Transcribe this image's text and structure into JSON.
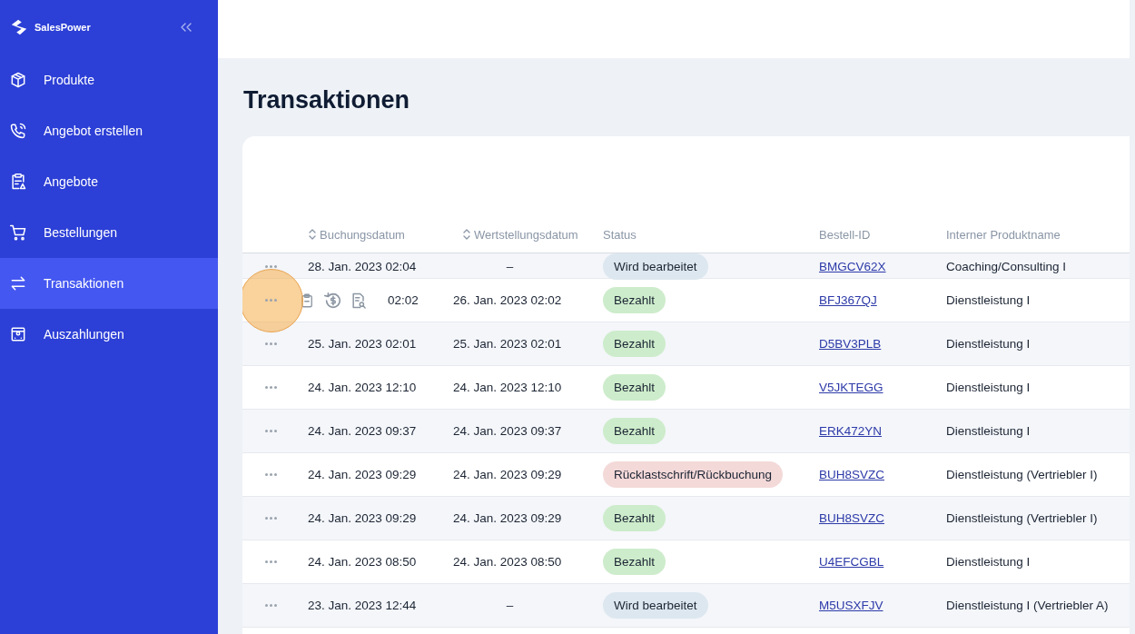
{
  "brand": {
    "name": "SalesPower"
  },
  "sidebar": {
    "items": [
      {
        "label": "Produkte",
        "kind": "box",
        "selected": false
      },
      {
        "label": "Angebot erstellen",
        "kind": "phone",
        "selected": false
      },
      {
        "label": "Angebote",
        "kind": "clipboard",
        "selected": false
      },
      {
        "label": "Bestellungen",
        "kind": "cart",
        "selected": false
      },
      {
        "label": "Transaktionen",
        "kind": "swap",
        "selected": true
      },
      {
        "label": "Auszahlungen",
        "kind": "payout",
        "selected": false
      }
    ]
  },
  "page": {
    "title": "Transaktionen"
  },
  "table": {
    "columns": [
      {
        "label": "Buchungsdatum",
        "sortable": true
      },
      {
        "label": "Wertstellungsdatum",
        "sortable": true
      },
      {
        "label": "Status",
        "sortable": false
      },
      {
        "label": "Bestell-ID",
        "sortable": false
      },
      {
        "label": "Interner Produktname",
        "sortable": false
      }
    ],
    "rows": [
      {
        "booking": "28. Jan. 2023 02:04",
        "value": "–",
        "status": "Wird bearbeitet",
        "color": "#dde7ef",
        "order_id": "BMGCV62X",
        "product": "Coaching/Consulting I",
        "hovered": false
      },
      {
        "booking": "02:02",
        "value": "26. Jan. 2023 02:02",
        "status": "Bezahlt",
        "color": "#cdeccb",
        "order_id": "BFJ367QJ",
        "product": "Dienstleistung I",
        "hovered": true
      },
      {
        "booking": "25. Jan. 2023 02:01",
        "value": "25. Jan. 2023 02:01",
        "status": "Bezahlt",
        "color": "#cdeccb",
        "order_id": "D5BV3PLB",
        "product": "Dienstleistung I",
        "hovered": false
      },
      {
        "booking": "24. Jan. 2023 12:10",
        "value": "24. Jan. 2023 12:10",
        "status": "Bezahlt",
        "color": "#cdeccb",
        "order_id": "V5JKTEGG",
        "product": "Dienstleistung I",
        "hovered": false
      },
      {
        "booking": "24. Jan. 2023 09:37",
        "value": "24. Jan. 2023 09:37",
        "status": "Bezahlt",
        "color": "#cdeccb",
        "order_id": "ERK472YN",
        "product": "Dienstleistung I",
        "hovered": false
      },
      {
        "booking": "24. Jan. 2023 09:29",
        "value": "24. Jan. 2023 09:29",
        "status": "Rücklastschrift/Rückbuchung",
        "color": "#f4d9d9",
        "order_id": "BUH8SVZC",
        "product": "Dienstleistung (Vertriebler I)",
        "hovered": false
      },
      {
        "booking": "24. Jan. 2023 09:29",
        "value": "24. Jan. 2023 09:29",
        "status": "Bezahlt",
        "color": "#cdeccb",
        "order_id": "BUH8SVZC",
        "product": "Dienstleistung (Vertriebler I)",
        "hovered": false
      },
      {
        "booking": "24. Jan. 2023 08:50",
        "value": "24. Jan. 2023 08:50",
        "status": "Bezahlt",
        "color": "#cdeccb",
        "order_id": "U4EFCGBL",
        "product": "Dienstleistung I",
        "hovered": false
      },
      {
        "booking": "23. Jan. 2023 12:44",
        "value": "–",
        "status": "Wird bearbeitet",
        "color": "#dde7ef",
        "order_id": "M5USXFJV",
        "product": "Dienstleistung I (Vertriebler A)",
        "hovered": false
      }
    ]
  }
}
